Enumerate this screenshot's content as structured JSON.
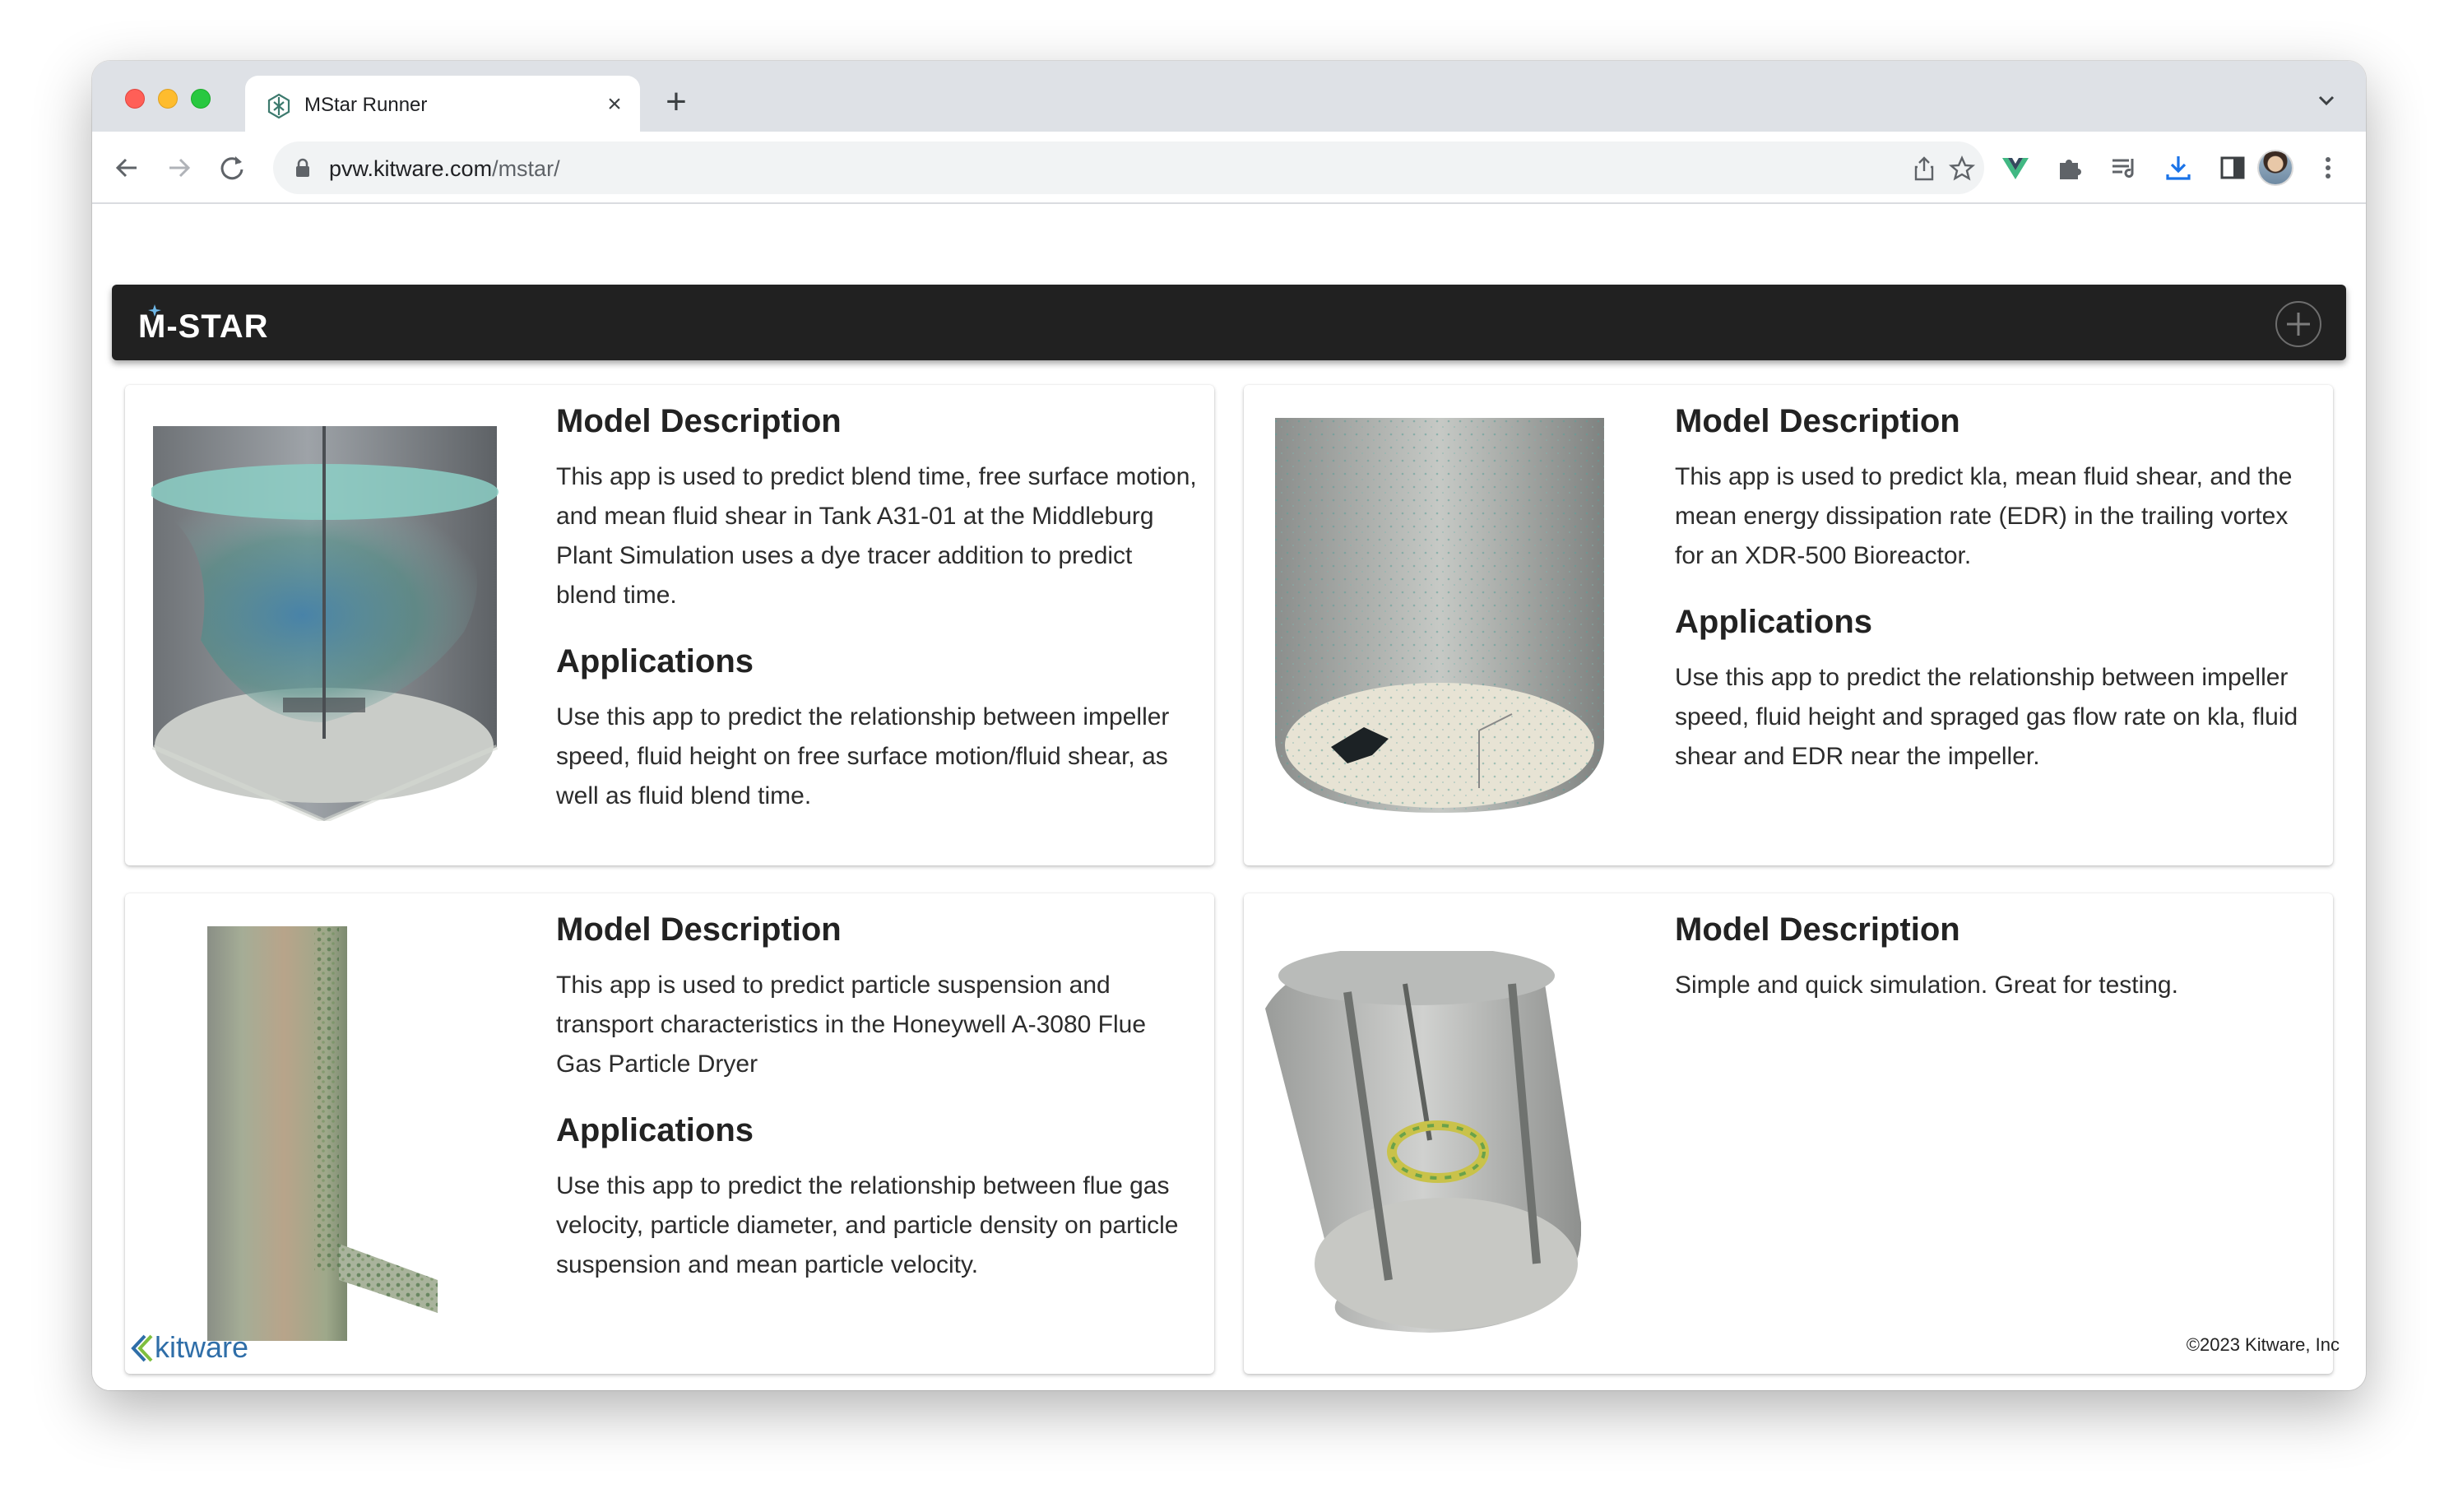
{
  "browser": {
    "tab_title": "MStar Runner",
    "url_domain": "pvw.kitware.com",
    "url_path": "/mstar/"
  },
  "app": {
    "brand": "M-STAR"
  },
  "cards": [
    {
      "heading1": "Model Description",
      "description": "This app is used to predict blend time, free surface motion, and mean fluid shear in Tank A31-01 at the Middleburg Plant Simulation uses a dye tracer addition to predict blend time.",
      "heading2": "Applications",
      "applications": "Use this app to predict the relationship between impeller speed, fluid height on free surface motion/fluid shear, as well as fluid blend time."
    },
    {
      "heading1": "Model Description",
      "description": "This app is used to predict kla, mean fluid shear, and the mean energy dissipation rate (EDR) in the trailing vortex for an XDR-500 Bioreactor.",
      "heading2": "Applications",
      "applications": "Use this app to predict the relationship between impeller speed, fluid height and spraged gas flow rate on kla, fluid shear and EDR near the impeller."
    },
    {
      "heading1": "Model Description",
      "description": "This app is used to predict particle suspension and transport characteristics in the Honeywell A-3080 Flue Gas Particle Dryer",
      "heading2": "Applications",
      "applications": "Use this app to predict the relationship between flue gas velocity, particle diameter, and particle density on particle suspension and mean particle velocity."
    },
    {
      "heading1": "Model Description",
      "description": "Simple and quick simulation. Great for testing."
    }
  ],
  "footer": {
    "logo_text": "kitware",
    "copyright": "©2023 Kitware, Inc"
  }
}
